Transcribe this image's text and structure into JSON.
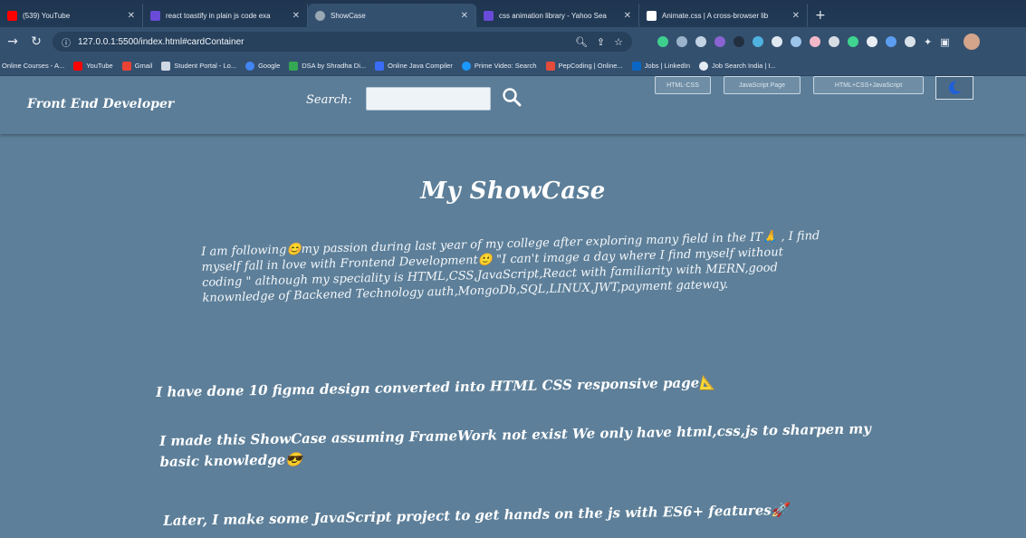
{
  "browser": {
    "tabs": [
      {
        "title": "(539) YouTube",
        "favicon_color": "#ff0000",
        "active": false
      },
      {
        "title": "react toastify in plain js code exa",
        "favicon_color": "#6a4bd8",
        "active": false
      },
      {
        "title": "ShowCase",
        "favicon_color": "#9aa7b4",
        "active": true
      },
      {
        "title": "css animation library - Yahoo Sea",
        "favicon_color": "#6a4bd8",
        "active": false
      },
      {
        "title": "Animate.css | A cross-browser lib",
        "favicon_color": "#ffffff",
        "active": false
      }
    ],
    "new_tab_symbol": "+",
    "url": "127.0.0.1:5500/index.html#cardContainer",
    "bookmarks": [
      {
        "label": "Online Courses - A...",
        "icon_color": "#f5a623"
      },
      {
        "label": "YouTube",
        "icon_color": "#ff0000"
      },
      {
        "label": "Gmail",
        "icon_color": "#ea4335"
      },
      {
        "label": "Student Portal - Lo...",
        "icon_color": "#cfd8e3"
      },
      {
        "label": "Google",
        "icon_color": "#4285f4"
      },
      {
        "label": "DSA by Shradha Di...",
        "icon_color": "#34a853"
      },
      {
        "label": "Online Java Compiler",
        "icon_color": "#3b6cf5"
      },
      {
        "label": "Prime Video: Search",
        "icon_color": "#1a98ff"
      },
      {
        "label": "PepCoding | Online...",
        "icon_color": "#e34b3b"
      },
      {
        "label": "Jobs | LinkedIn",
        "icon_color": "#0a66c2"
      },
      {
        "label": "Job Search India | I...",
        "icon_color": "#e6ecf3"
      }
    ]
  },
  "site": {
    "brand": "Front End Developer",
    "search_label": "Search:",
    "search_placeholder": "",
    "nav_links": [
      "HTML-CSS",
      "JavaScript Page",
      "HTML+CSS+JavaScript"
    ],
    "theme_icon": "moon-icon"
  },
  "main": {
    "title": "My ShowCase",
    "intro": "I am following😊my passion during last year of my college after exploring many field in the IT🙏 , I find myself fall in love with Frontend Development🙂 \"I can't image a day where I find myself without coding \" although my speciality is HTML,CSS,JavaScript,React with familiarity with MERN,good knownledge of Backened Technology auth,MongoDb,SQL,LINUX,JWT,payment gateway.",
    "paragraphs": [
      "I have done 10 figma design converted into HTML CSS responsive page📐",
      "I made this ShowCase assuming FrameWork not exist We only have html,css,js to sharpen my basic knowledge😎",
      "Later, I make some JavaScript project to get hands on the js with ES6+ features🚀"
    ]
  },
  "colors": {
    "page_bg": "#5d7f99",
    "browser_chrome": "#34506f",
    "text": "#ffffff"
  }
}
